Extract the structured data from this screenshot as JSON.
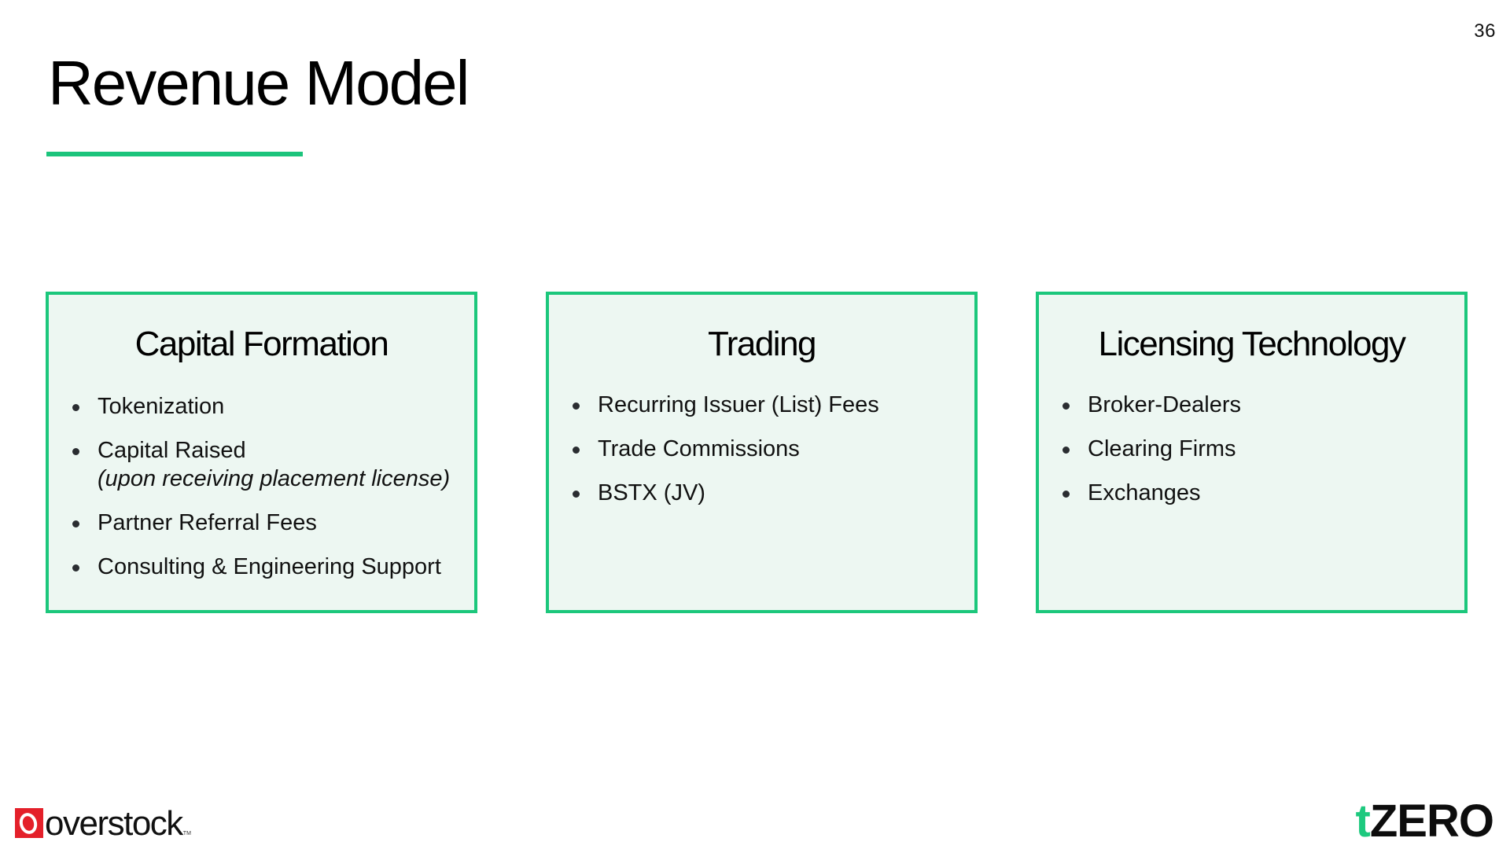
{
  "page_number": "36",
  "title": "Revenue Model",
  "colors": {
    "accent_green": "#1cc77c",
    "card_fill": "#edf7f2",
    "overstock_red": "#e4202a"
  },
  "cards": [
    {
      "title": "Capital Formation",
      "items": [
        {
          "label": "Tokenization"
        },
        {
          "label": "Capital Raised",
          "note": "(upon receiving placement license)"
        },
        {
          "label": "Partner Referral Fees"
        },
        {
          "label": "Consulting & Engineering Support"
        }
      ]
    },
    {
      "title": "Trading",
      "items": [
        {
          "label": "Recurring Issuer (List) Fees"
        },
        {
          "label": "Trade Commissions"
        },
        {
          "label": "BSTX (JV)"
        }
      ]
    },
    {
      "title": "Licensing Technology",
      "items": [
        {
          "label": "Broker-Dealers"
        },
        {
          "label": "Clearing Firms"
        },
        {
          "label": "Exchanges"
        }
      ]
    }
  ],
  "logos": {
    "overstock": {
      "word": "overstock",
      "tm": "TM",
      "icon": "overstock-o-icon"
    },
    "tzero": {
      "t": "t",
      "rest": "ZERO"
    }
  }
}
